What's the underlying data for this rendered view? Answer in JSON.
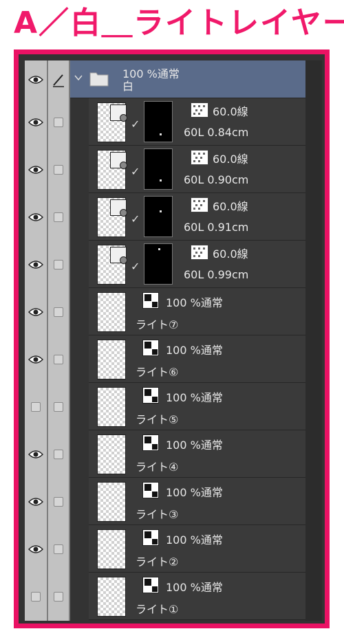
{
  "title": "A／白＿ライトレイヤー",
  "folder": {
    "opacity_blend": "100 %通常",
    "name": "白"
  },
  "tone_layers": [
    {
      "top": "60.0線",
      "bottom": "60L 0.84cm"
    },
    {
      "top": "60.0線",
      "bottom": "60L 0.90cm"
    },
    {
      "top": "60.0線",
      "bottom": "60L 0.91cm"
    },
    {
      "top": "60.0線",
      "bottom": "60L 0.99cm"
    }
  ],
  "light_layers": [
    {
      "blend": "100 %通常",
      "name": "ライト⑦",
      "visible": true
    },
    {
      "blend": "100 %通常",
      "name": "ライト⑥",
      "visible": true
    },
    {
      "blend": "100 %通常",
      "name": "ライト⑤",
      "visible": false
    },
    {
      "blend": "100 %通常",
      "name": "ライト④",
      "visible": true
    },
    {
      "blend": "100 %通常",
      "name": "ライト③",
      "visible": true
    },
    {
      "blend": "100 %通常",
      "name": "ライト②",
      "visible": true
    },
    {
      "blend": "100 %通常",
      "name": "ライト①",
      "visible": false
    }
  ],
  "colors": {
    "highlight_border": "#ea1264",
    "title": "#f0196a",
    "selected_row": "#5a6b8a"
  },
  "icons": {
    "visibility": "eye-icon",
    "lock": "checkbox",
    "folder": "folder-icon",
    "expand": "chevron-down-icon",
    "edit": "pencil-icon"
  }
}
